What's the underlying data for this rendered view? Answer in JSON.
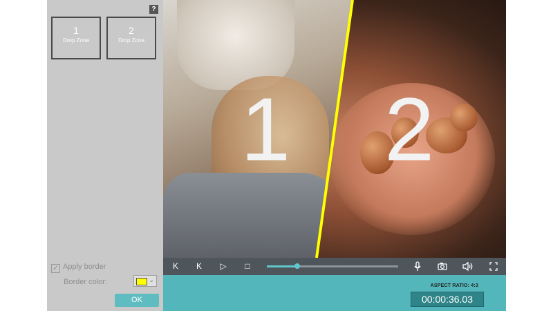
{
  "panel": {
    "help_label": "?",
    "zones": [
      {
        "number": "1",
        "label": "Drop Zone"
      },
      {
        "number": "2",
        "label": "Drop Zone"
      }
    ],
    "apply_border_label": "Apply border",
    "border_color_label": "Border color:",
    "border_color": "#ffff00",
    "ok_label": "OK"
  },
  "video": {
    "overlay_1": "1",
    "overlay_2": "2",
    "divider_color": "#ffff00"
  },
  "controls": {
    "buttons": [
      {
        "name": "previous-icon",
        "glyph": "K"
      },
      {
        "name": "next-icon",
        "glyph": "K"
      },
      {
        "name": "play-icon",
        "glyph": "▷"
      },
      {
        "name": "stop-icon",
        "glyph": "□"
      }
    ],
    "progress": 0.23
  },
  "info": {
    "aspect_ratio": "ASPECT RATIO: 4:3",
    "timecode": "00:00:36.03"
  }
}
